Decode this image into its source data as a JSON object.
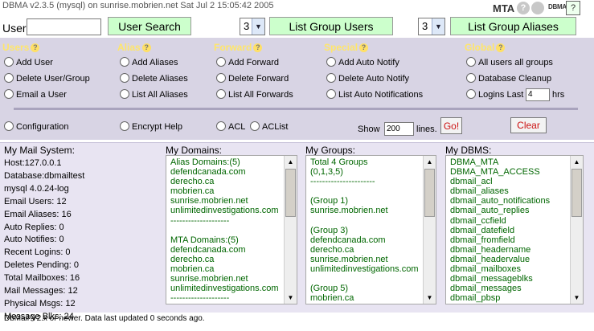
{
  "header": {
    "title": "DBMA v2.3.5 (mysql) on sunrise.mobrien.net Sat Jul 2 15:05:42 2005",
    "mta_label": "MTA",
    "dbma_label": "DBMA",
    "help_icon": "?"
  },
  "search": {
    "user_label": "User",
    "user_value": "",
    "user_search_button": "User Search",
    "group_select_value": "3",
    "list_group_users_button": "List Group Users",
    "alias_select_value": "3",
    "list_group_aliases_button": "List Group Aliases"
  },
  "panel": {
    "users": {
      "heading": "Users",
      "items": [
        "Add User",
        "Delete User/Group",
        "Email a User"
      ]
    },
    "alias": {
      "heading": "Alias",
      "items": [
        "Add Aliases",
        "Delete Aliases",
        "List All Aliases"
      ]
    },
    "forward": {
      "heading": "Forward",
      "items": [
        "Add Forward",
        "Delete Forward",
        "List All Forwards"
      ]
    },
    "special": {
      "heading": "Special",
      "items": [
        "Add Auto Notify",
        "Delete Auto Notify",
        "List Auto Notifications"
      ]
    },
    "global": {
      "heading": "Global",
      "items": [
        "All users all groups",
        "Database Cleanup",
        "Logins Last"
      ]
    },
    "logins_last_value": "4",
    "hrs_label": "hrs",
    "bottom_options": [
      "Configuration",
      "Encrypt Help",
      "ACL",
      "ACList"
    ],
    "show_label": "Show",
    "show_value": "200",
    "lines_label": "lines.",
    "go_button": "Go!",
    "clear_button": "Clear"
  },
  "info": {
    "mail_system": {
      "title": "My Mail System:",
      "lines": [
        "Host:127.0.0.1",
        "Database:dbmailtest",
        "mysql 4.0.24-log",
        "Email Users: 12",
        "Email Aliases: 16",
        "Auto Replies: 0",
        "Auto Notifies: 0",
        "Recent Logins: 0",
        "Deletes Pending: 0",
        "Total Mailboxes: 16",
        "Mail Messages: 12",
        "Physical Msgs: 12",
        "Message Blks: 24"
      ]
    },
    "domains": {
      "title": "My Domains:",
      "lines": [
        "Alias Domains:(5)",
        "defendcanada.com",
        "derecho.ca",
        "mobrien.ca",
        "sunrise.mobrien.net",
        "unlimitedinvestigations.com",
        "--------------------",
        "",
        "MTA Domains:(5)",
        "defendcanada.com",
        "derecho.ca",
        "mobrien.ca",
        "sunrise.mobrien.net",
        "unlimitedinvestigations.com",
        "--------------------"
      ]
    },
    "groups": {
      "title": "My Groups:",
      "lines": [
        "Total 4 Groups",
        "(0,1,3,5)",
        "----------------------",
        "",
        "(Group 1)",
        "sunrise.mobrien.net",
        "",
        "(Group 3)",
        "defendcanada.com",
        "derecho.ca",
        "sunrise.mobrien.net",
        "unlimitedinvestigations.com",
        "",
        "(Group 5)",
        "mobrien.ca"
      ]
    },
    "dbms": {
      "title": "My DBMS:",
      "lines": [
        "DBMA_MTA",
        "DBMA_MTA_ACCESS",
        "dbmail_acl",
        "dbmail_aliases",
        "dbmail_auto_notifications",
        "dbmail_auto_replies",
        "dbmail_ccfield",
        "dbmail_datefield",
        "dbmail_fromfield",
        "dbmail_headername",
        "dbmail_headervalue",
        "dbmail_mailboxes",
        "dbmail_messageblks",
        "dbmail_messages",
        "dbmail_pbsp"
      ]
    }
  },
  "footer": "DbMail V2.x or newer. Data last updated 0 seconds ago.",
  "colors": {
    "panel_bg": "#d8d4e4",
    "heading_yellow": "#ffe66a",
    "button_green": "#ccffcc",
    "list_text_green": "#006600",
    "button_red_text": "#cc1111"
  }
}
